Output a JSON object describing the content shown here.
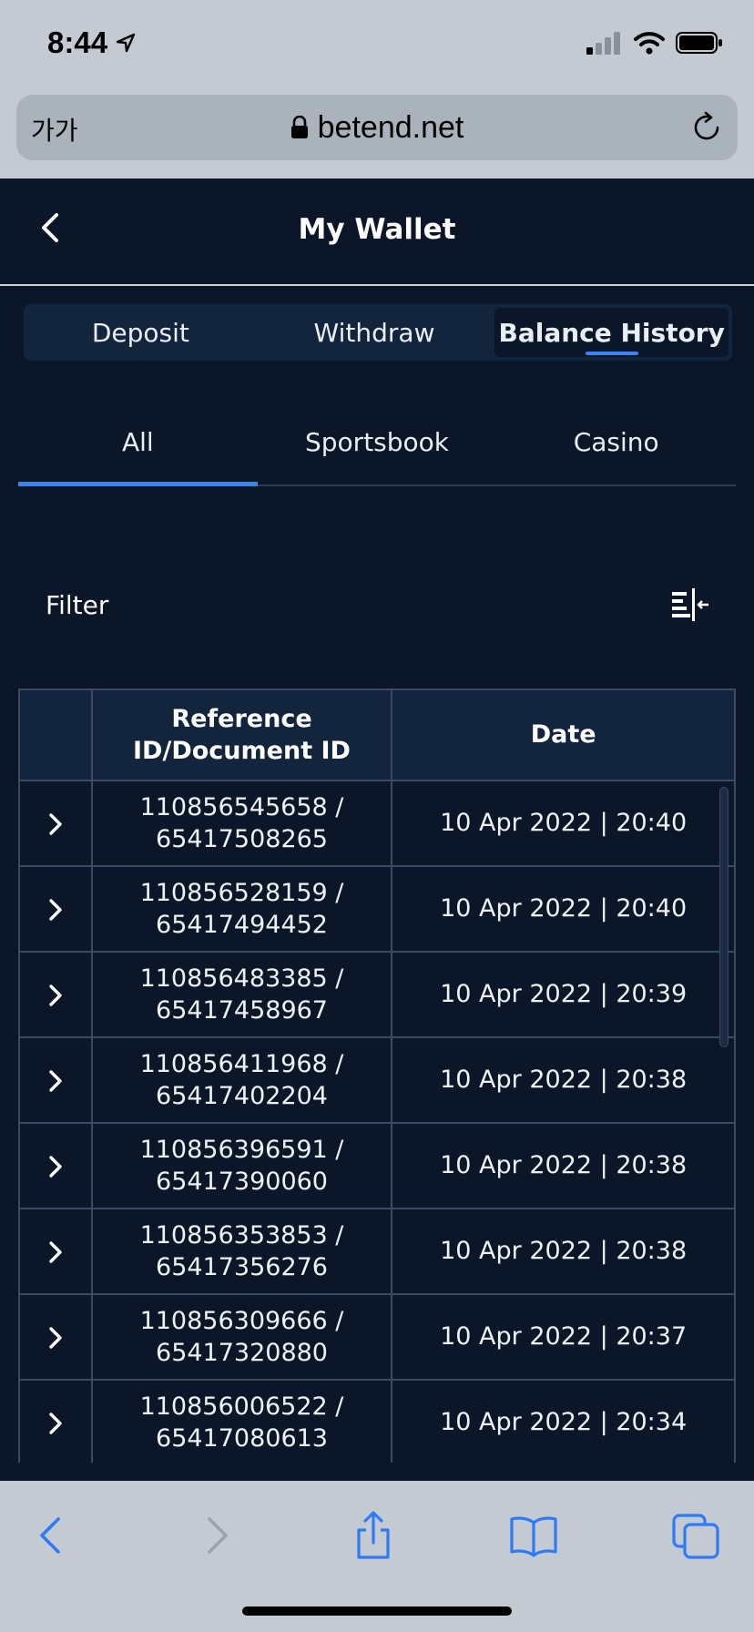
{
  "status_bar": {
    "time": "8:44"
  },
  "browser": {
    "text_size_label": "가가",
    "url": "betend.net"
  },
  "header": {
    "title": "My Wallet"
  },
  "wallet_tabs": [
    {
      "label": "Deposit",
      "active": false
    },
    {
      "label": "Withdraw",
      "active": false
    },
    {
      "label": "Balance History",
      "active": true
    }
  ],
  "sub_tabs": [
    {
      "label": "All",
      "active": true
    },
    {
      "label": "Sportsbook",
      "active": false
    },
    {
      "label": "Casino",
      "active": false
    }
  ],
  "filter": {
    "label": "Filter"
  },
  "table": {
    "headers": {
      "reference_line1": "Reference",
      "reference_line2": "ID/Document ID",
      "date": "Date"
    },
    "rows": [
      {
        "ref": "110856545658 /",
        "doc": "65417508265",
        "date": "10 Apr 2022 | 20:40"
      },
      {
        "ref": "110856528159 /",
        "doc": "65417494452",
        "date": "10 Apr 2022 | 20:40"
      },
      {
        "ref": "110856483385 /",
        "doc": "65417458967",
        "date": "10 Apr 2022 | 20:39"
      },
      {
        "ref": "110856411968 /",
        "doc": "65417402204",
        "date": "10 Apr 2022 | 20:38"
      },
      {
        "ref": "110856396591 /",
        "doc": "65417390060",
        "date": "10 Apr 2022 | 20:38"
      },
      {
        "ref": "110856353853 /",
        "doc": "65417356276",
        "date": "10 Apr 2022 | 20:38"
      },
      {
        "ref": "110856309666 /",
        "doc": "65417320880",
        "date": "10 Apr 2022 | 20:37"
      },
      {
        "ref": "110856006522 /",
        "doc": "65417080613",
        "date": "10 Apr 2022 | 20:34"
      }
    ]
  },
  "colors": {
    "accent": "#3b82f6",
    "background": "#0b1628",
    "surface": "#13243d",
    "chrome": "#c4cad2",
    "safari_blue": "#2f7bf6"
  },
  "icons": {
    "status": [
      "location-arrow-icon",
      "cellular-signal-icon",
      "wifi-icon",
      "battery-icon"
    ],
    "toolbar": [
      "back-icon",
      "forward-icon",
      "share-icon",
      "bookmarks-icon",
      "tabs-icon"
    ]
  }
}
